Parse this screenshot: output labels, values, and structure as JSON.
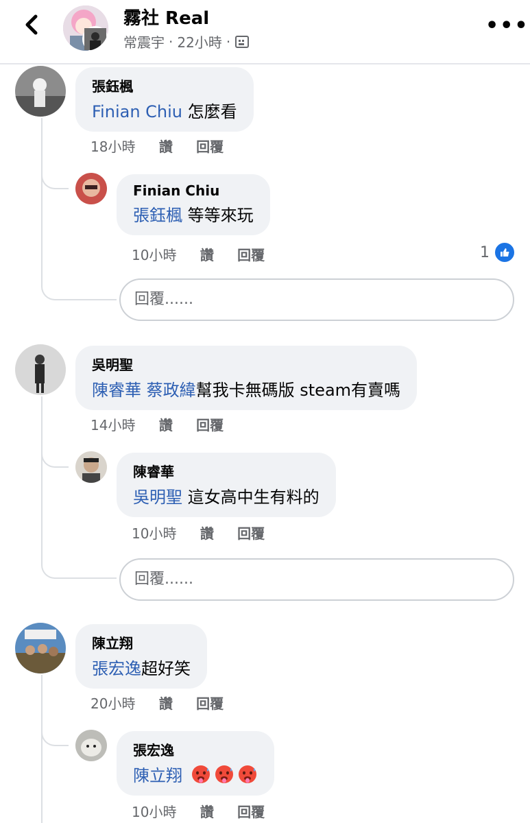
{
  "header": {
    "title": "霧社 Real",
    "author": "常震宇",
    "time": "22小時",
    "separator": "·"
  },
  "threads": [
    {
      "author": "張鈺楓",
      "mentions": [
        "Finian Chiu"
      ],
      "text": "怎麼看",
      "time": "18小時",
      "like_label": "讚",
      "reply_label": "回覆",
      "reply": {
        "author": "Finian Chiu",
        "mentions": [
          "張鈺楓"
        ],
        "text": "等等來玩",
        "time": "10小時",
        "like_label": "讚",
        "reply_label": "回覆",
        "like_count": "1"
      },
      "reply_placeholder": "回覆......"
    },
    {
      "author": "吳明聖",
      "mentions": [
        "陳睿華",
        "蔡政緯"
      ],
      "text": "幫我卡無碼版 steam有賣嗎",
      "time": "14小時",
      "like_label": "讚",
      "reply_label": "回覆",
      "reply": {
        "author": "陳睿華",
        "mentions": [
          "吳明聖"
        ],
        "text": "這女高中生有料的",
        "time": "10小時",
        "like_label": "讚",
        "reply_label": "回覆"
      },
      "reply_placeholder": "回覆......"
    },
    {
      "author": "陳立翔",
      "mentions": [
        "張宏逸"
      ],
      "text": "超好笑",
      "time": "20小時",
      "like_label": "讚",
      "reply_label": "回覆",
      "reply": {
        "author": "張宏逸",
        "mentions": [
          "陳立翔"
        ],
        "emojis": [
          "hot-face",
          "hot-face",
          "hot-face"
        ],
        "time": "10小時",
        "like_label": "讚",
        "reply_label": "回覆"
      }
    }
  ],
  "colors": {
    "mention": "#2d5fb3",
    "bubble": "#f0f2f5",
    "like_blue": "#1b74e4",
    "meta": "#65676b"
  },
  "icons": {
    "back": "chevron-left-icon",
    "more": "more-horizontal-icon",
    "audience": "photo-icon",
    "like": "thumbs-up-icon"
  }
}
